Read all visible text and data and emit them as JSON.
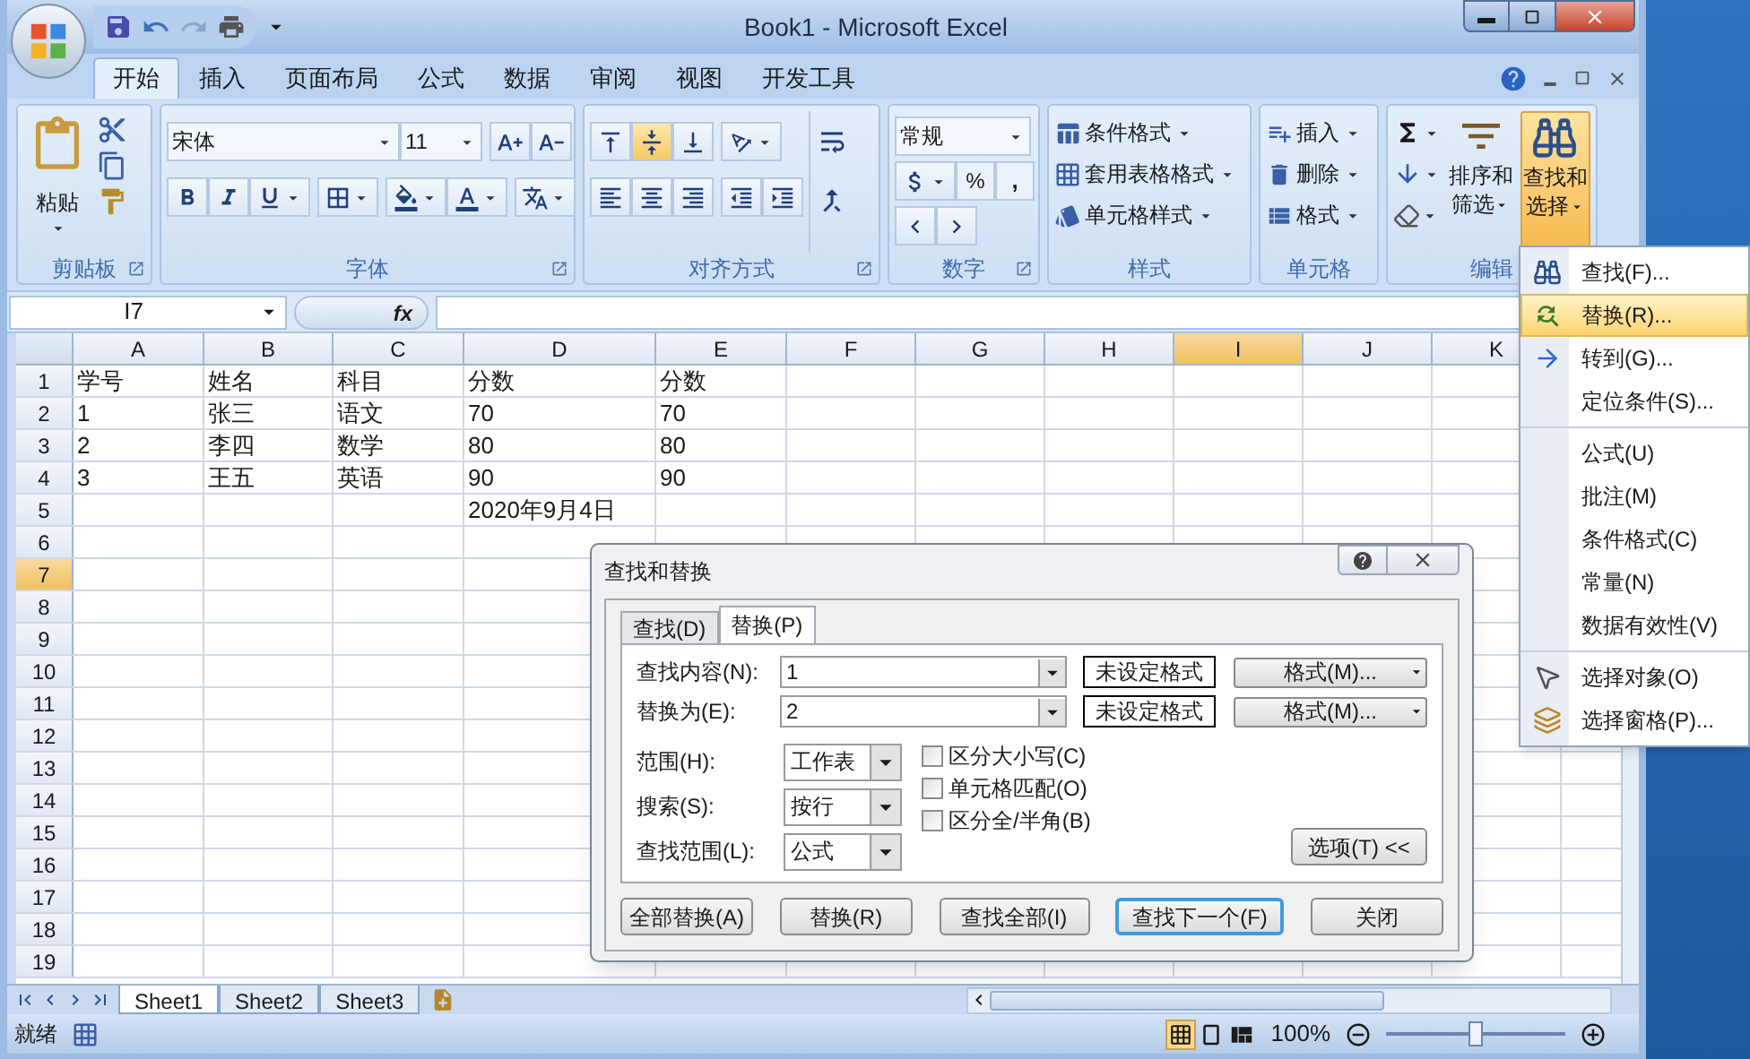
{
  "window": {
    "title": "Book1 - Microsoft Excel"
  },
  "tabs": [
    {
      "label": "开始",
      "selected": true
    },
    {
      "label": "插入",
      "selected": false
    },
    {
      "label": "页面布局",
      "selected": false
    },
    {
      "label": "公式",
      "selected": false
    },
    {
      "label": "数据",
      "selected": false
    },
    {
      "label": "审阅",
      "selected": false
    },
    {
      "label": "视图",
      "selected": false
    },
    {
      "label": "开发工具",
      "selected": false
    }
  ],
  "ribbon": {
    "clipboard": {
      "label": "剪贴板",
      "paste": "粘贴"
    },
    "font": {
      "label": "字体",
      "font_name": "宋体",
      "font_size": "11"
    },
    "alignment": {
      "label": "对齐方式",
      "vertical": [
        {
          "selected": false
        },
        {
          "selected": true
        },
        {
          "selected": false
        }
      ]
    },
    "number": {
      "label": "数字",
      "format": "常规",
      "percent": "%",
      "comma": ","
    },
    "styles": {
      "label": "样式",
      "items": [
        "条件格式",
        "套用表格格式",
        "单元格样式"
      ]
    },
    "cells": {
      "label": "单元格",
      "items": [
        "插入",
        "删除",
        "格式"
      ]
    },
    "editing": {
      "label": "编辑",
      "sort_filter": [
        "排序和",
        "筛选"
      ],
      "find_select": [
        "查找和",
        "选择"
      ],
      "find_select_expanded": true
    }
  },
  "formula_bar": {
    "name_box": "I7",
    "fx": "fx"
  },
  "columns": [
    {
      "label": "A",
      "selected": false
    },
    {
      "label": "B",
      "selected": false
    },
    {
      "label": "C",
      "selected": false
    },
    {
      "label": "D",
      "selected": false
    },
    {
      "label": "E",
      "selected": false
    },
    {
      "label": "F",
      "selected": false
    },
    {
      "label": "G",
      "selected": false
    },
    {
      "label": "H",
      "selected": false
    },
    {
      "label": "I",
      "selected": true
    },
    {
      "label": "J",
      "selected": false
    },
    {
      "label": "K",
      "selected": false
    }
  ],
  "rows": [
    {
      "number": "1",
      "selected": false,
      "cells": {
        "A": "学号",
        "B": "姓名",
        "C": "科目",
        "D": "分数",
        "E": "分数"
      }
    },
    {
      "number": "2",
      "selected": false,
      "cells": {
        "A": "1",
        "B": "张三",
        "C": "语文",
        "D": "70",
        "E": "70"
      }
    },
    {
      "number": "3",
      "selected": false,
      "cells": {
        "A": "2",
        "B": "李四",
        "C": "数学",
        "D": "80",
        "E": "80"
      }
    },
    {
      "number": "4",
      "selected": false,
      "cells": {
        "A": "3",
        "B": "王五",
        "C": "英语",
        "D": "90",
        "E": "90"
      }
    },
    {
      "number": "5",
      "selected": false,
      "cells": {
        "D": "2020年9月4日"
      }
    },
    {
      "number": "6",
      "selected": false
    },
    {
      "number": "7",
      "selected": true
    },
    {
      "number": "8",
      "selected": false
    },
    {
      "number": "9",
      "selected": false
    },
    {
      "number": "10",
      "selected": false
    },
    {
      "number": "11",
      "selected": false
    },
    {
      "number": "12",
      "selected": false
    },
    {
      "number": "13",
      "selected": false
    },
    {
      "number": "14",
      "selected": false
    },
    {
      "number": "15",
      "selected": false
    },
    {
      "number": "16",
      "selected": false
    },
    {
      "number": "17",
      "selected": false
    },
    {
      "number": "18",
      "selected": false
    },
    {
      "number": "19",
      "selected": false
    }
  ],
  "sheet_tabs": [
    {
      "label": "Sheet1",
      "selected": true
    },
    {
      "label": "Sheet2",
      "selected": false
    },
    {
      "label": "Sheet3",
      "selected": false
    }
  ],
  "status_bar": {
    "status": "就绪",
    "zoom": "100%",
    "zoom_slider": {
      "level": 0.5
    }
  },
  "menu": {
    "sections": [
      [
        {
          "label": "查找(F)...",
          "selected": false
        },
        {
          "label": "替换(R)...",
          "selected": true
        },
        {
          "label": "转到(G)...",
          "selected": false
        },
        {
          "label": "定位条件(S)...",
          "selected": false
        }
      ],
      [
        {
          "label": "公式(U)",
          "selected": false
        },
        {
          "label": "批注(M)",
          "selected": false
        },
        {
          "label": "条件格式(C)",
          "selected": false
        },
        {
          "label": "常量(N)",
          "selected": false
        },
        {
          "label": "数据有效性(V)",
          "selected": false
        }
      ],
      [
        {
          "label": "选择对象(O)",
          "selected": false
        },
        {
          "label": "选择窗格(P)...",
          "selected": false
        }
      ]
    ]
  },
  "dialog": {
    "title": "查找和替换",
    "tabs": [
      {
        "label": "查找(D)",
        "selected": false
      },
      {
        "label": "替换(P)",
        "selected": true
      }
    ],
    "fields": [
      {
        "label": "查找内容(N):",
        "value": "1",
        "format_preview": "未设定格式",
        "format_button": "格式(M)..."
      },
      {
        "label": "替换为(E):",
        "value": "2",
        "format_preview": "未设定格式",
        "format_button": "格式(M)..."
      }
    ],
    "selects": [
      {
        "label": "范围(H):",
        "value": "工作表"
      },
      {
        "label": "搜索(S):",
        "value": "按行"
      },
      {
        "label": "查找范围(L):",
        "value": "公式"
      }
    ],
    "checkboxes": [
      {
        "label": "区分大小写(C)",
        "checked": false
      },
      {
        "label": "单元格匹配(O)",
        "checked": false
      },
      {
        "label": "区分全/半角(B)",
        "checked": false
      }
    ],
    "options_button": "选项(T) <<",
    "buttons": [
      {
        "label": "全部替换(A)",
        "focused": false
      },
      {
        "label": "替换(R)",
        "focused": false
      },
      {
        "label": "查找全部(I)",
        "focused": false
      },
      {
        "label": "查找下一个(F)",
        "focused": true
      },
      {
        "label": "关闭",
        "focused": false
      }
    ]
  }
}
